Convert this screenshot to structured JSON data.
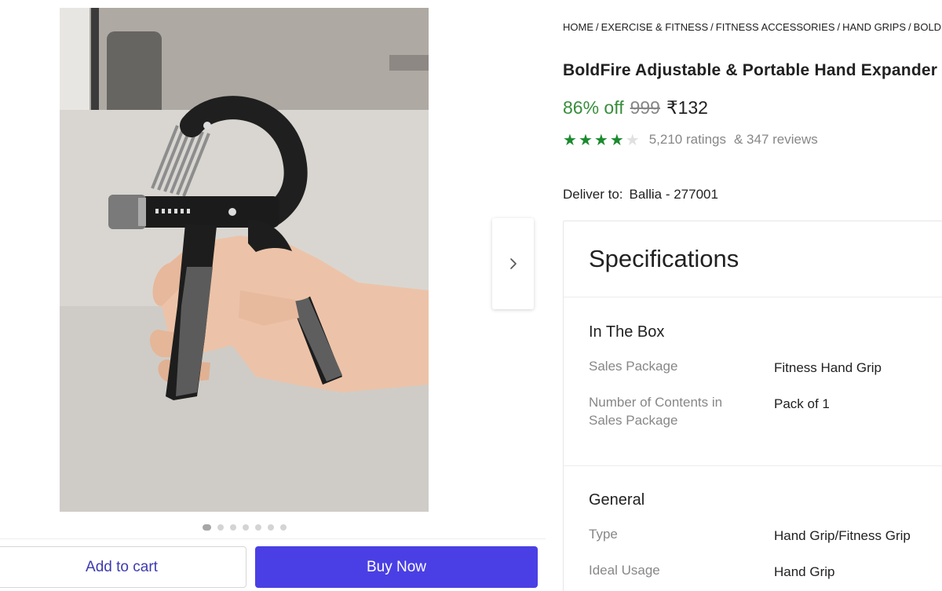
{
  "breadcrumb": [
    "HOME",
    "EXERCISE & FITNESS",
    "FITNESS ACCESSORIES",
    "HAND GRIPS",
    "BOLD"
  ],
  "product": {
    "title": "BoldFire Adjustable & Portable Hand Expander H",
    "discount": "86% off",
    "mrp": "999",
    "price": "₹132",
    "rating_value": 4,
    "rating_max": 5,
    "ratings": "5,210 ratings",
    "reviews": "& 347 reviews"
  },
  "carousel": {
    "count": 7,
    "active": 0
  },
  "delivery": {
    "label": "Deliver to:",
    "location": "Ballia - 277001"
  },
  "actions": {
    "add_to_cart": "Add to cart",
    "buy_now": "Buy Now"
  },
  "specifications": {
    "heading": "Specifications",
    "sections": [
      {
        "title": "In The Box",
        "rows": [
          {
            "key": "Sales Package",
            "value": "Fitness Hand Grip"
          },
          {
            "key": "Number of Contents in Sales Package",
            "value": "Pack of 1"
          }
        ]
      },
      {
        "title": "General",
        "rows": [
          {
            "key": "Type",
            "value": "Hand Grip/Fitness Grip"
          },
          {
            "key": "Ideal Usage",
            "value": "Hand Grip"
          }
        ]
      }
    ]
  },
  "colors": {
    "accent": "#4a3fe4",
    "discount": "#388e3c",
    "star": "#1b8a2e"
  },
  "icons": {
    "next": "chevron-right-icon",
    "rating": "star-icon"
  }
}
